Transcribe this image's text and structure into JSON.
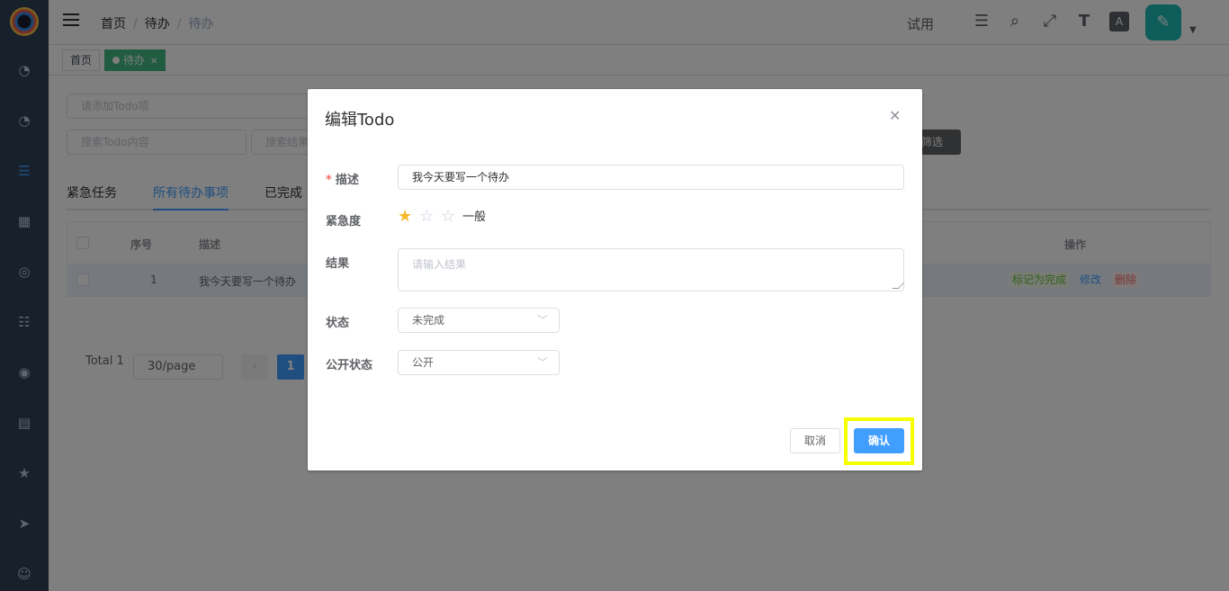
{
  "breadcrumb": {
    "home": "首页",
    "parent": "待办",
    "current": "待办"
  },
  "header": {
    "trial_label": "试用"
  },
  "tags": {
    "home": "首页",
    "active": "待办"
  },
  "page": {
    "add_placeholder": "请添加Todo项",
    "search_content_placeholder": "搜索Todo内容",
    "search_result_placeholder": "搜索结果",
    "filter_label": "筛选",
    "tabs": [
      "紧急任务",
      "所有待办事项",
      "已完成"
    ],
    "table": {
      "headers": {
        "seq": "序号",
        "desc": "描述",
        "ops": "操作"
      },
      "rows": [
        {
          "seq": "1",
          "desc": "我今天要写一个待办"
        }
      ],
      "ops": {
        "done": "标记为完成",
        "edit": "修改",
        "delete": "删除"
      }
    },
    "pagination": {
      "total": "Total 1",
      "page_size": "30/page",
      "current_page": "1"
    }
  },
  "dialog": {
    "title": "编辑Todo",
    "labels": {
      "desc": "描述",
      "urgency": "紧急度",
      "result": "结果",
      "status": "状态",
      "visibility": "公开状态"
    },
    "desc_value": "我今天要写一个待办",
    "urgency": {
      "rating": 1,
      "max": 3,
      "text": "一般"
    },
    "result_placeholder": "请输入结果",
    "status_value": "未完成",
    "visibility_value": "公开",
    "cancel_label": "取消",
    "confirm_label": "确认"
  },
  "colors": {
    "primary": "#409eff",
    "sidebar": "#304156",
    "tag_active": "#42b983",
    "highlight": "#f6ff00"
  }
}
